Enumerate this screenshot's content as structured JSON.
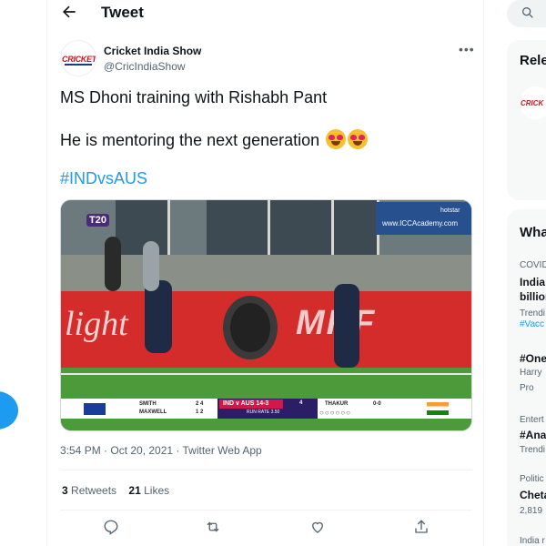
{
  "header": {
    "title": "Tweet"
  },
  "tweet": {
    "display_name": "Cricket India Show",
    "handle": "@CricIndiaShow",
    "avatar_text": "CRICKET",
    "line1": "MS Dhoni training with Rishabh Pant",
    "line2": "He is mentoring the next generation",
    "line2_emoji": "smiling-face-with-heart-eyes",
    "hashtag": "#INDvsAUS",
    "meta": "3:54 PM · Oct 20, 2021 · Twitter Web App",
    "retweets_count": "3",
    "retweets_label": "Retweets",
    "likes_count": "21",
    "likes_label": "Likes"
  },
  "media": {
    "ad_top": "hotstar",
    "ad_text": "www.ICCAcademy.com",
    "t20_badge": "T20",
    "banner_brand": "MRF",
    "banner_left": "light",
    "scoreboard": {
      "batter1": "SMITH",
      "batter1_score": "2 4",
      "batter2": "MAXWELL",
      "batter2_score": "1 2",
      "match": "IND v AUS",
      "score": "14-3",
      "overs": "4",
      "run_rate": "RUN RATE 3.50",
      "bowler": "THAKUR",
      "bowler_figures": "0-0",
      "balls": "○○○○○○"
    }
  },
  "right": {
    "relevant_title": "Rele",
    "relevant_avatar_text": "CRICK",
    "whats_title": "Wha",
    "t1_cat": "COVID",
    "t1_title_a": "India",
    "t1_title_b": "billion",
    "t1_trend": "Trendi",
    "t1_link": "#Vacc",
    "t2_title": "#One",
    "t2_by": "Harry",
    "t2_promo": "Pro",
    "t3_cat": "Entert",
    "t3_title": "#Ana",
    "t3_trend": "Trendi",
    "t4_cat": "Politic",
    "t4_title": "Cheta",
    "t4_count": "2,819",
    "t5_cat": "India r"
  },
  "colors": {
    "accent": "#1d9bf0",
    "banner": "#d42b2b"
  }
}
